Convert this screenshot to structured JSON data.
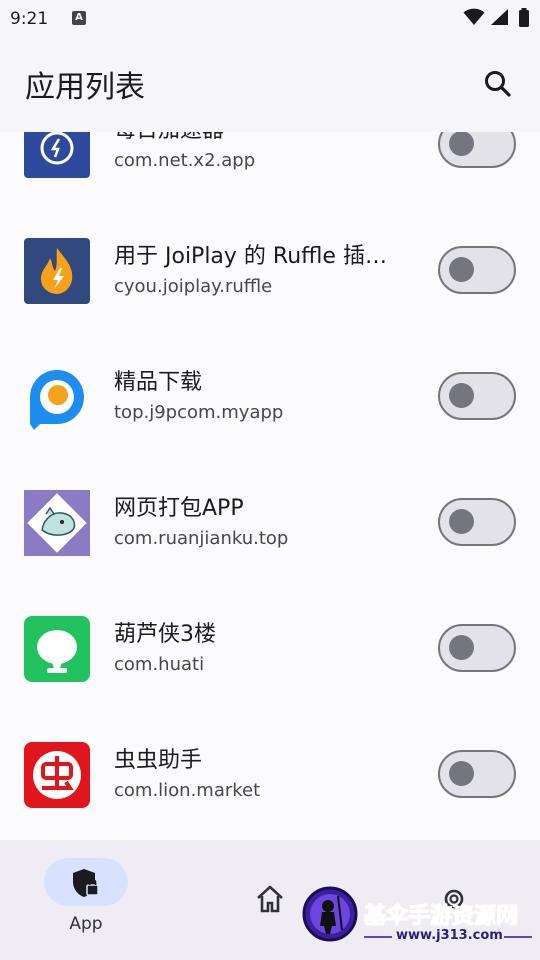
{
  "status_bar": {
    "time": "9:21",
    "notification_icon_letter": "A",
    "icons": [
      "wifi-icon",
      "signal-icon",
      "battery-icon"
    ]
  },
  "app_bar": {
    "title": "应用列表",
    "search_icon": "search-icon"
  },
  "apps": [
    {
      "name": "每日加速器",
      "package": "com.net.x2.app",
      "enabled": false,
      "icon": "timer-app-icon"
    },
    {
      "name": "用于 JoiPlay 的 Ruffle 插…",
      "package": "cyou.joiplay.ruffle",
      "enabled": false,
      "icon": "flame-app-icon"
    },
    {
      "name": "精品下载",
      "package": "top.j9pcom.myapp",
      "enabled": false,
      "icon": "p-logo-app-icon"
    },
    {
      "name": "网页打包APP",
      "package": "com.ruanjianku.top",
      "enabled": false,
      "icon": "cartoon-app-icon"
    },
    {
      "name": "葫芦侠3楼",
      "package": "com.huati",
      "enabled": false,
      "icon": "gourd-app-icon"
    },
    {
      "name": "虫虫助手",
      "package": "com.lion.market",
      "enabled": false,
      "icon": "chong-app-icon"
    }
  ],
  "bottom_nav": {
    "items": [
      {
        "label": "App",
        "icon": "shield-lock-icon",
        "selected": true
      },
      {
        "label": "",
        "icon": "home-icon",
        "selected": false
      },
      {
        "label": "",
        "icon": "gear-icon",
        "selected": false
      }
    ]
  },
  "watermark": {
    "title": "基伞手游资源网",
    "url": "www.j313.com"
  },
  "colors": {
    "background": "#f6f5f9",
    "toggle_outline": "#74757f",
    "nav_indicator": "#d8e2ff"
  }
}
